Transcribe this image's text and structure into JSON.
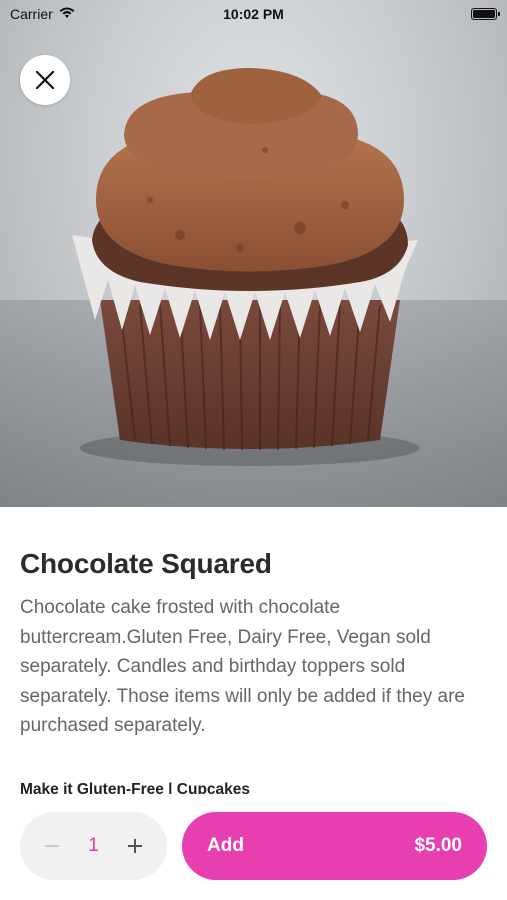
{
  "status_bar": {
    "carrier": "Carrier",
    "time": "10:02 PM",
    "wifi_icon": "wifi-icon",
    "battery_icon": "battery-icon"
  },
  "close_icon": "close-icon",
  "product": {
    "title": "Chocolate Squared",
    "description": "Chocolate cake frosted with chocolate buttercream.Gluten Free, Dairy Free, Vegan sold separately. Candles and birthday toppers sold separately. Those items will only be added if they are purchased separately."
  },
  "section": {
    "title": "Make it Gluten-Free | Cupcakes"
  },
  "order": {
    "quantity": "1",
    "minus_icon": "minus-icon",
    "plus_icon": "plus-icon",
    "add_label": "Add",
    "price": "$5.00"
  },
  "colors": {
    "accent": "#e83fb0",
    "quantity": "#e535a8"
  }
}
